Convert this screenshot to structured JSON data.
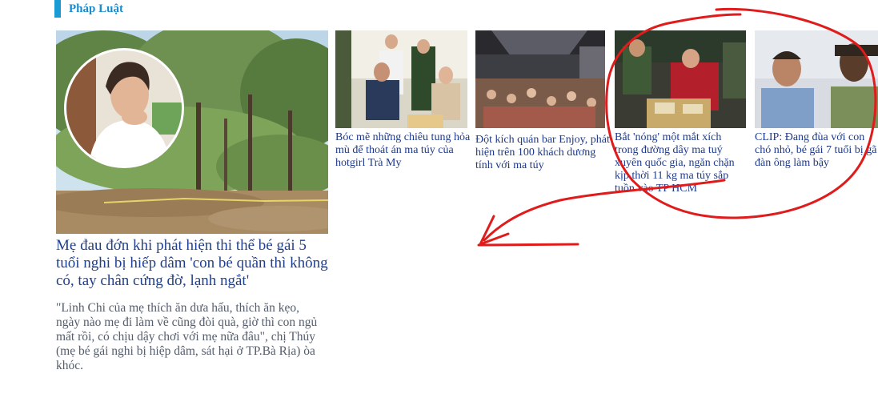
{
  "section": {
    "title": "Pháp Luật",
    "accent": "#1a9bd6"
  },
  "lead_article": {
    "title": "Mẹ đau đớn khi phát hiện thi thể bé gái 5 tuổi nghi bị hiếp dâm 'con bé quần thì không có, tay chân cứng đờ, lạnh ngắt'",
    "summary": "\"Linh Chi của mẹ thích ăn dưa hấu, thích ăn kẹo, ngày nào mẹ đi làm về cũng đòi quà, giờ thì con ngủ mất rồi, có chịu dậy chơi với mẹ nữa đâu\", chị Thúy (mẹ bé gái nghi bị hiệp dâm, sát hại ở TP.Bà Rịa) òa khóc."
  },
  "articles": [
    {
      "title": "Bóc mẽ những chiêu tung hỏa mù để thoát án ma túy của hotgirl Trà My"
    },
    {
      "title": "Đột kích quán bar Enjoy, phát hiện trên 100 khách dương tính với ma túy"
    },
    {
      "title": "Bắt 'nóng' một mắt xích trong đường dây ma tuý xuyên quốc gia, ngăn chặn kịp thời 11 kg ma túy sắp tuồn vào TP HCM"
    },
    {
      "title": "CLIP: Đang đùa với con chó nhỏ, bé gái 7 tuổi bị gã đàn ông làm bậy"
    }
  ],
  "annotation_color": "#e01b1b",
  "link_color": "#1e3a8a"
}
